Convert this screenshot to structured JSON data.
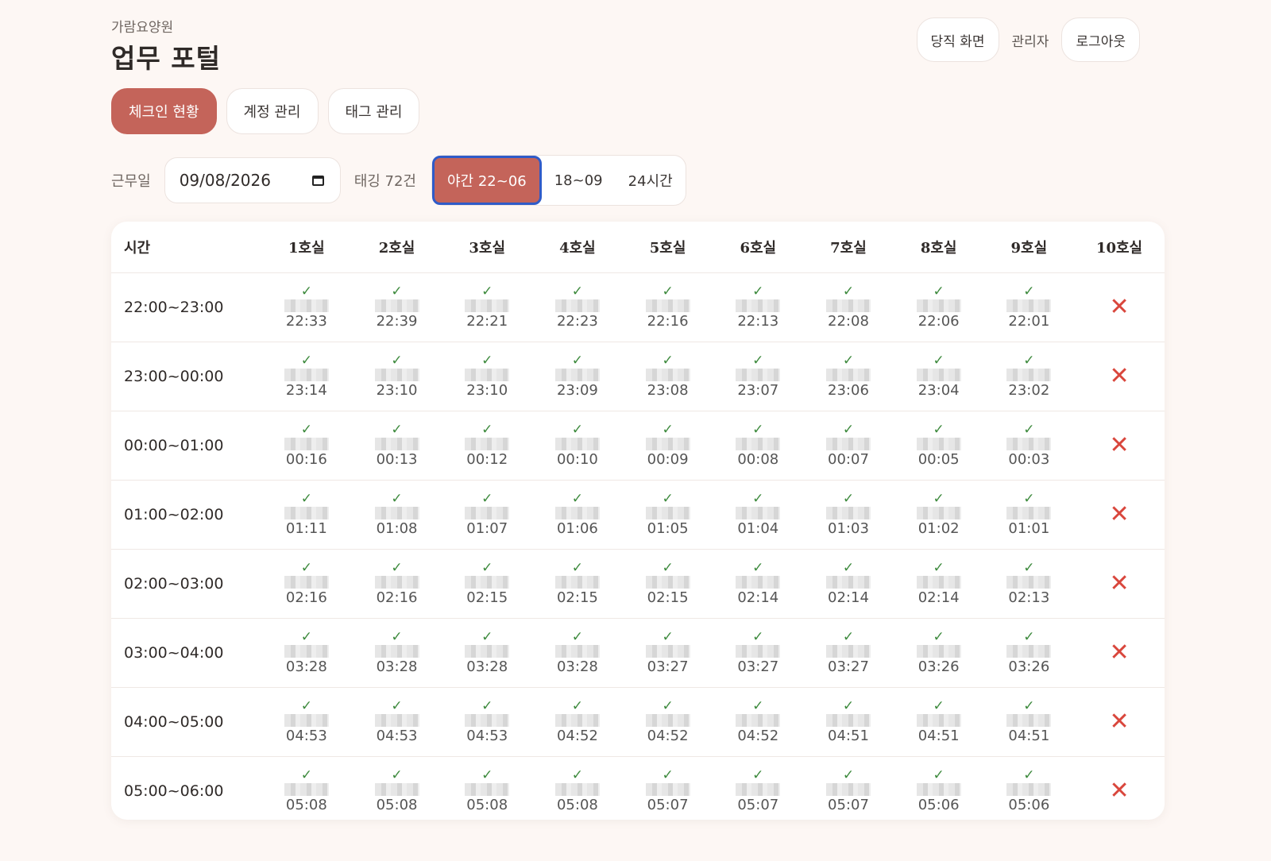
{
  "header": {
    "org": "가람요양원",
    "title": "업무 포털"
  },
  "top_actions": {
    "duty_screen": "당직 화면",
    "role": "관리자",
    "logout": "로그아웃"
  },
  "tabs": [
    {
      "label": "체크인 현황",
      "active": true
    },
    {
      "label": "계정 관리",
      "active": false
    },
    {
      "label": "태그 관리",
      "active": false
    }
  ],
  "filters": {
    "date_label": "근무일",
    "date_value": "09/08/2026",
    "tag_count": "태깅 72건",
    "ranges": [
      {
        "label": "야간 22~06",
        "active": true
      },
      {
        "label": "18~09",
        "active": false
      },
      {
        "label": "24시간",
        "active": false
      }
    ]
  },
  "table": {
    "time_header": "시간",
    "rooms": [
      "1호실",
      "2호실",
      "3호실",
      "4호실",
      "5호실",
      "6호실",
      "7호실",
      "8호실",
      "9호실",
      "10호실"
    ],
    "rows": [
      {
        "slot": "22:00~23:00",
        "times": [
          "22:33",
          "22:39",
          "22:21",
          "22:23",
          "22:16",
          "22:13",
          "22:08",
          "22:06",
          "22:01",
          null
        ]
      },
      {
        "slot": "23:00~00:00",
        "times": [
          "23:14",
          "23:10",
          "23:10",
          "23:09",
          "23:08",
          "23:07",
          "23:06",
          "23:04",
          "23:02",
          null
        ]
      },
      {
        "slot": "00:00~01:00",
        "times": [
          "00:16",
          "00:13",
          "00:12",
          "00:10",
          "00:09",
          "00:08",
          "00:07",
          "00:05",
          "00:03",
          null
        ]
      },
      {
        "slot": "01:00~02:00",
        "times": [
          "01:11",
          "01:08",
          "01:07",
          "01:06",
          "01:05",
          "01:04",
          "01:03",
          "01:02",
          "01:01",
          null
        ]
      },
      {
        "slot": "02:00~03:00",
        "times": [
          "02:16",
          "02:16",
          "02:15",
          "02:15",
          "02:15",
          "02:14",
          "02:14",
          "02:14",
          "02:13",
          null
        ]
      },
      {
        "slot": "03:00~04:00",
        "times": [
          "03:28",
          "03:28",
          "03:28",
          "03:28",
          "03:27",
          "03:27",
          "03:27",
          "03:26",
          "03:26",
          null
        ]
      },
      {
        "slot": "04:00~05:00",
        "times": [
          "04:53",
          "04:53",
          "04:53",
          "04:52",
          "04:52",
          "04:52",
          "04:51",
          "04:51",
          "04:51",
          null
        ]
      },
      {
        "slot": "05:00~06:00",
        "times": [
          "05:08",
          "05:08",
          "05:08",
          "05:08",
          "05:07",
          "05:07",
          "05:07",
          "05:06",
          "05:06",
          null
        ]
      }
    ],
    "check_icon": "checkmark-icon",
    "missing_icon": "x-icon",
    "colors": {
      "check": "#3d8a3d",
      "missing": "#d9463c",
      "accent": "#c4645a",
      "focus": "#2f5bc8"
    }
  }
}
